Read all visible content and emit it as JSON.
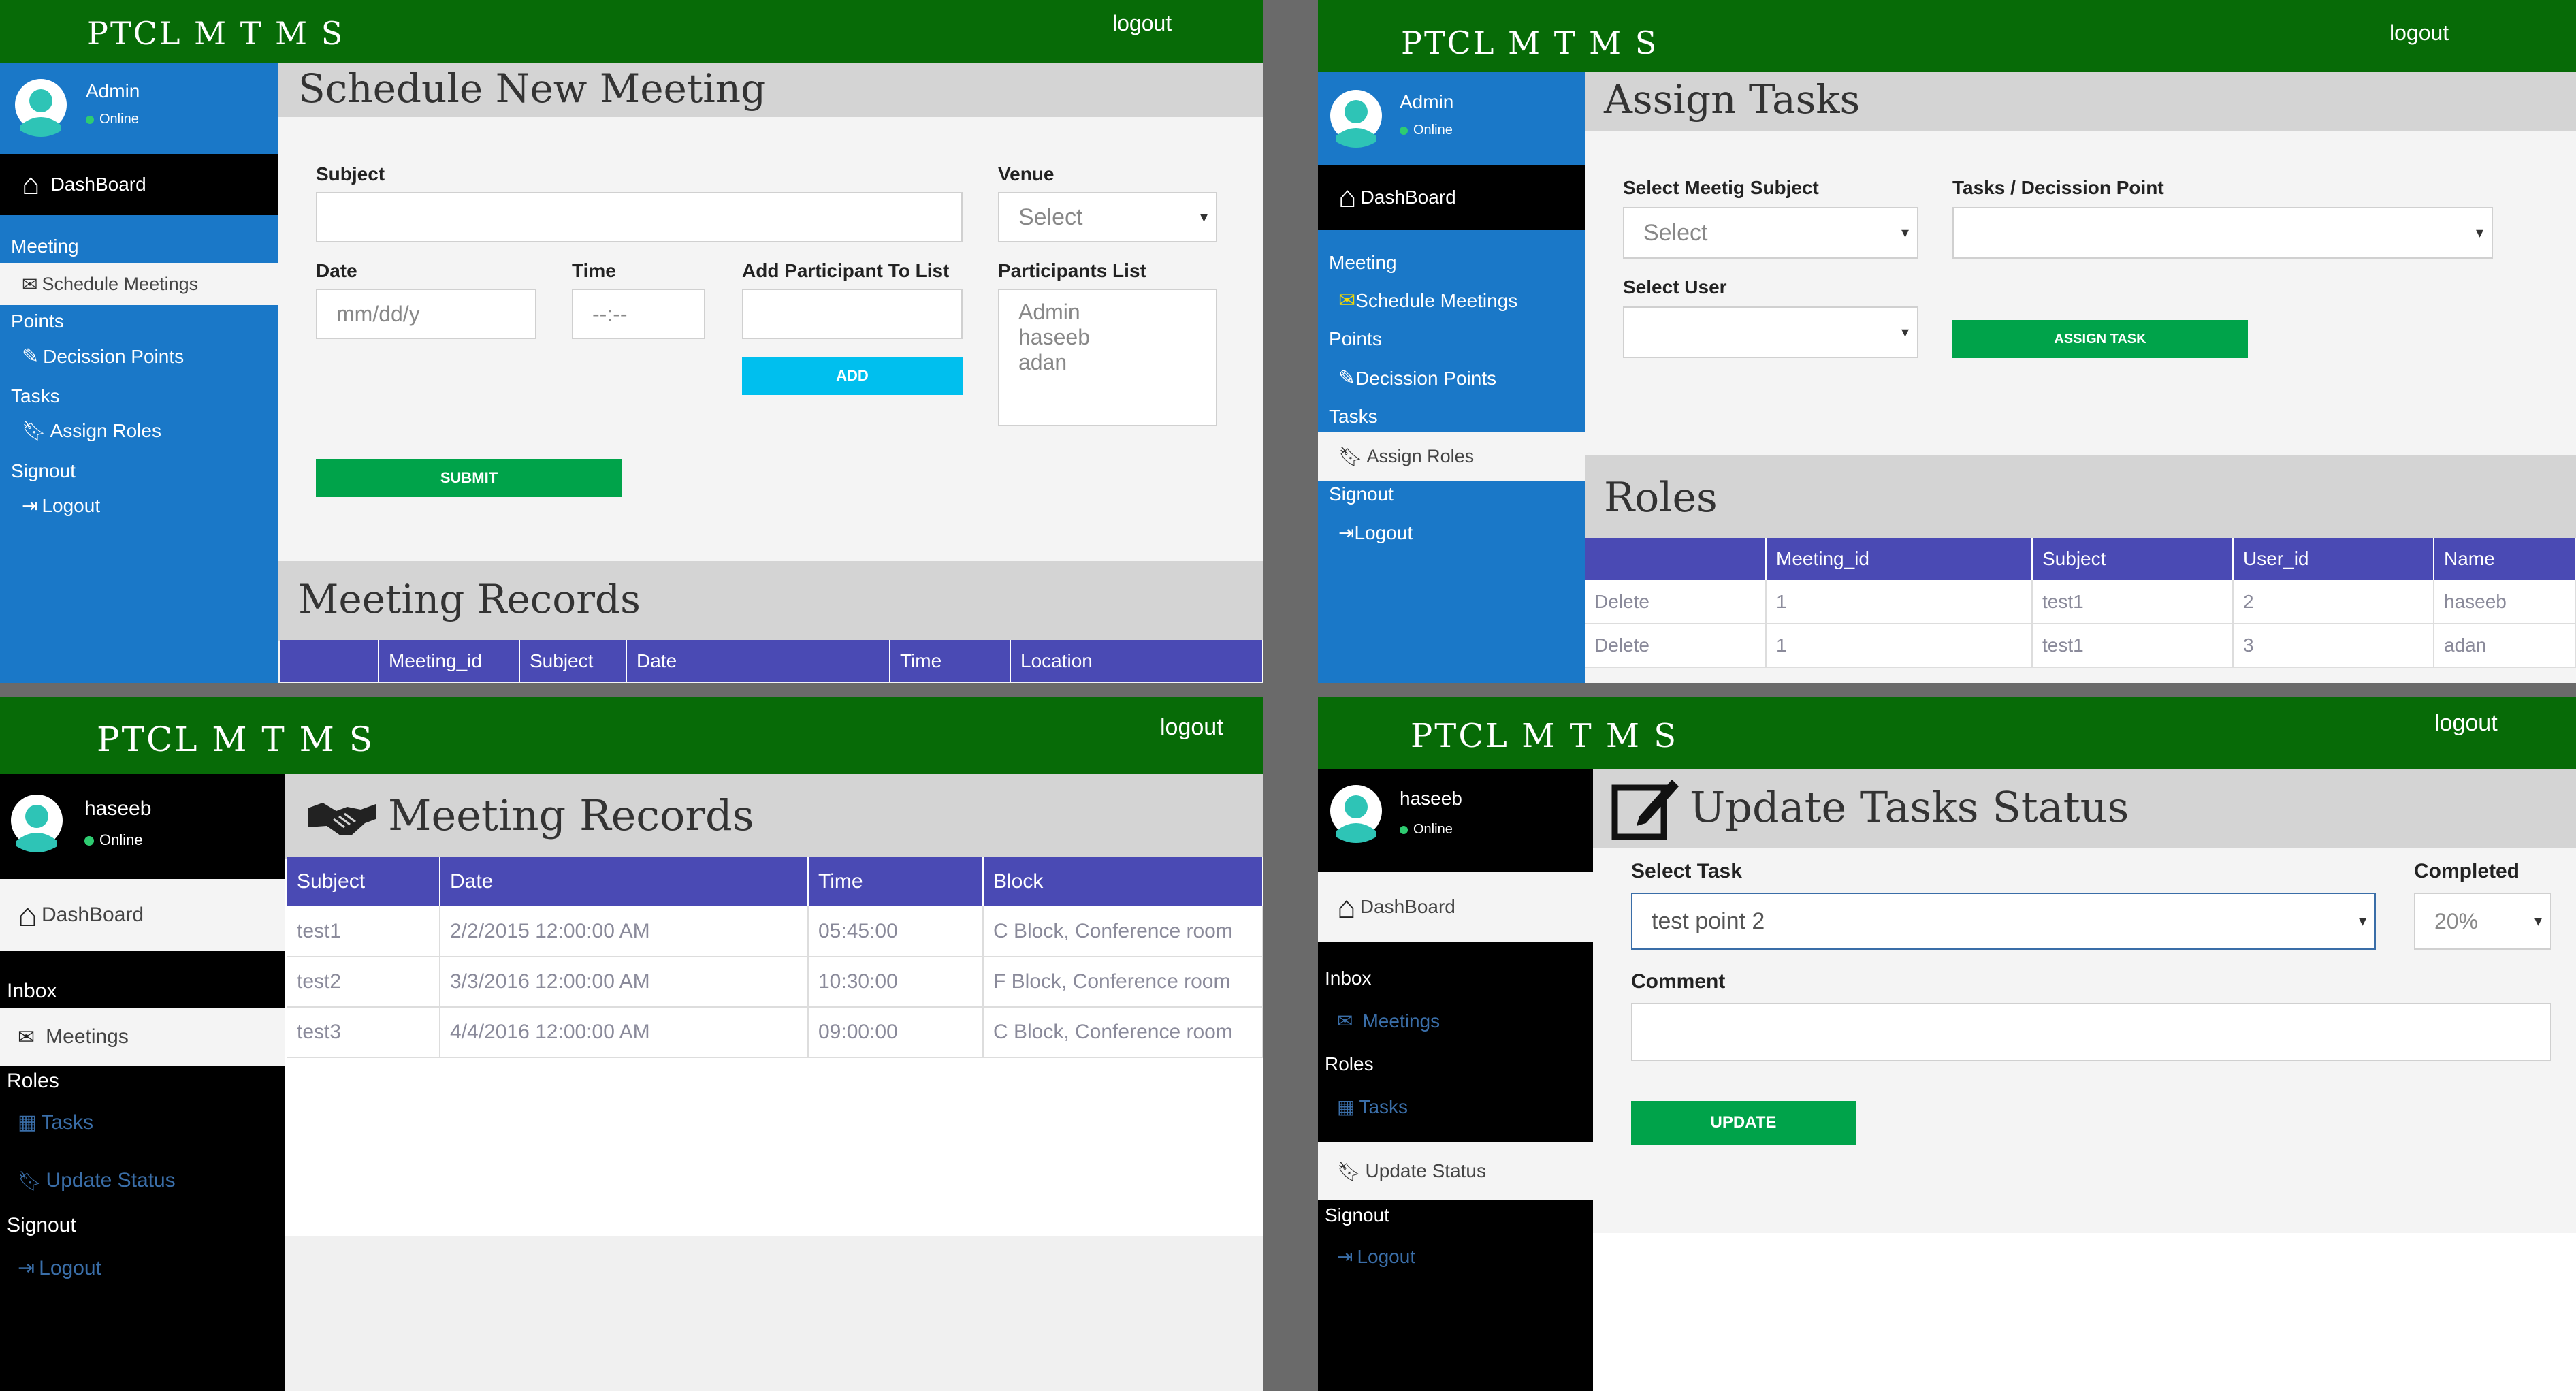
{
  "app": {
    "brand": "PTCL M T M S",
    "logout": "logout"
  },
  "colors": {
    "header": "#076b07",
    "sidebar_blue": "#1a78c8",
    "table_header": "#4a4ab4",
    "button": "#00a34a",
    "add_button": "#00bfee"
  },
  "panel1": {
    "user": {
      "name": "Admin",
      "status": "Online"
    },
    "nav": {
      "dashboard": "DashBoard",
      "meeting_section": "Meeting",
      "schedule": "Schedule Meetings",
      "points_section": "Points",
      "decision": "Decission Points",
      "tasks_section": "Tasks",
      "assign": "Assign Roles",
      "signout_section": "Signout",
      "logout": "Logout"
    },
    "title": "Schedule New Meeting",
    "form": {
      "subject_label": "Subject",
      "venue_label": "Venue",
      "venue_value": "Select",
      "date_label": "Date",
      "date_placeholder": "mm/dd/y",
      "time_label": "Time",
      "time_placeholder": "--:--",
      "participant_label": "Add Participant To List",
      "participants_list_label": "Participants List",
      "participants": [
        "Admin",
        "haseeb",
        "adan"
      ],
      "add_button": "ADD",
      "submit_button": "SUBMIT"
    },
    "records_title": "Meeting Records",
    "records_columns": [
      "",
      "Meeting_id",
      "Subject",
      "Date",
      "Time",
      "Location"
    ]
  },
  "panel2": {
    "user": {
      "name": "Admin",
      "status": "Online"
    },
    "nav": {
      "dashboard": "DashBoard",
      "meeting_section": "Meeting",
      "schedule": "Schedule Meetings",
      "points_section": "Points",
      "decision": "Decission Points",
      "tasks_section": "Tasks",
      "assign": "Assign Roles",
      "signout_section": "Signout",
      "logout": "Logout"
    },
    "title": "Assign Tasks",
    "form": {
      "subject_label": "Select Meetig Subject",
      "subject_value": "Select",
      "task_label": "Tasks / Decission Point",
      "user_label": "Select User",
      "assign_button": "ASSIGN TASK"
    },
    "roles_title": "Roles",
    "roles_columns": [
      "",
      "Meeting_id",
      "Subject",
      "User_id",
      "Name"
    ],
    "roles_rows": [
      [
        "Delete",
        "1",
        "test1",
        "2",
        "haseeb"
      ],
      [
        "Delete",
        "1",
        "test1",
        "3",
        "adan"
      ]
    ]
  },
  "panel3": {
    "user": {
      "name": "haseeb",
      "status": "Online"
    },
    "nav": {
      "dashboard": "DashBoard",
      "inbox_section": "Inbox",
      "meetings": "Meetings",
      "roles_section": "Roles",
      "tasks": "Tasks",
      "update_status": "Update Status",
      "signout_section": "Signout",
      "logout": "Logout"
    },
    "title": "Meeting Records",
    "columns": [
      "Subject",
      "Date",
      "Time",
      "Block"
    ],
    "rows": [
      [
        "test1",
        "2/2/2015 12:00:00 AM",
        "05:45:00",
        "C Block, Conference room"
      ],
      [
        "test2",
        "3/3/2016 12:00:00 AM",
        "10:30:00",
        "F Block, Conference room"
      ],
      [
        "test3",
        "4/4/2016 12:00:00 AM",
        "09:00:00",
        "C Block, Conference room"
      ]
    ]
  },
  "panel4": {
    "user": {
      "name": "haseeb",
      "status": "Online"
    },
    "nav": {
      "dashboard": "DashBoard",
      "inbox_section": "Inbox",
      "meetings": "Meetings",
      "roles_section": "Roles",
      "tasks": "Tasks",
      "update_status": "Update Status",
      "signout_section": "Signout",
      "logout": "Logout"
    },
    "title": "Update Tasks Status",
    "form": {
      "task_label": "Select Task",
      "task_value": "test point 2",
      "completed_label": "Completed",
      "completed_value": "20%",
      "comment_label": "Comment",
      "update_button": "UPDATE"
    }
  }
}
